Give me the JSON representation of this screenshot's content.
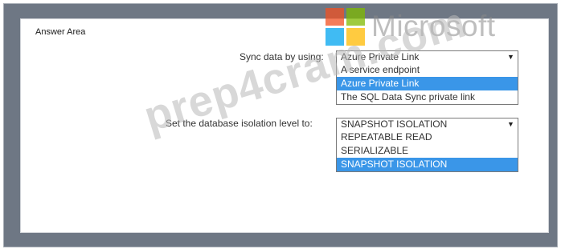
{
  "title": "Answer Area",
  "questions": [
    {
      "label": "Sync data by using:",
      "selected": "Azure Private Link",
      "options": [
        "A service endpoint",
        "Azure Private Link",
        "The SQL Data Sync private link"
      ],
      "highlighted_index": 1
    },
    {
      "label": "Set the database isolation level to:",
      "selected": "SNAPSHOT ISOLATION",
      "options": [
        "REPEATABLE READ",
        "SERIALIZABLE",
        "SNAPSHOT ISOLATION"
      ],
      "highlighted_index": 2
    }
  ],
  "logo": {
    "wordmark": "Microsoft",
    "colors": [
      "#f25022",
      "#7fba00",
      "#00a4ef",
      "#ffb900"
    ]
  },
  "watermark": "prep4cram.com",
  "highlight_color": "#3a96e8"
}
